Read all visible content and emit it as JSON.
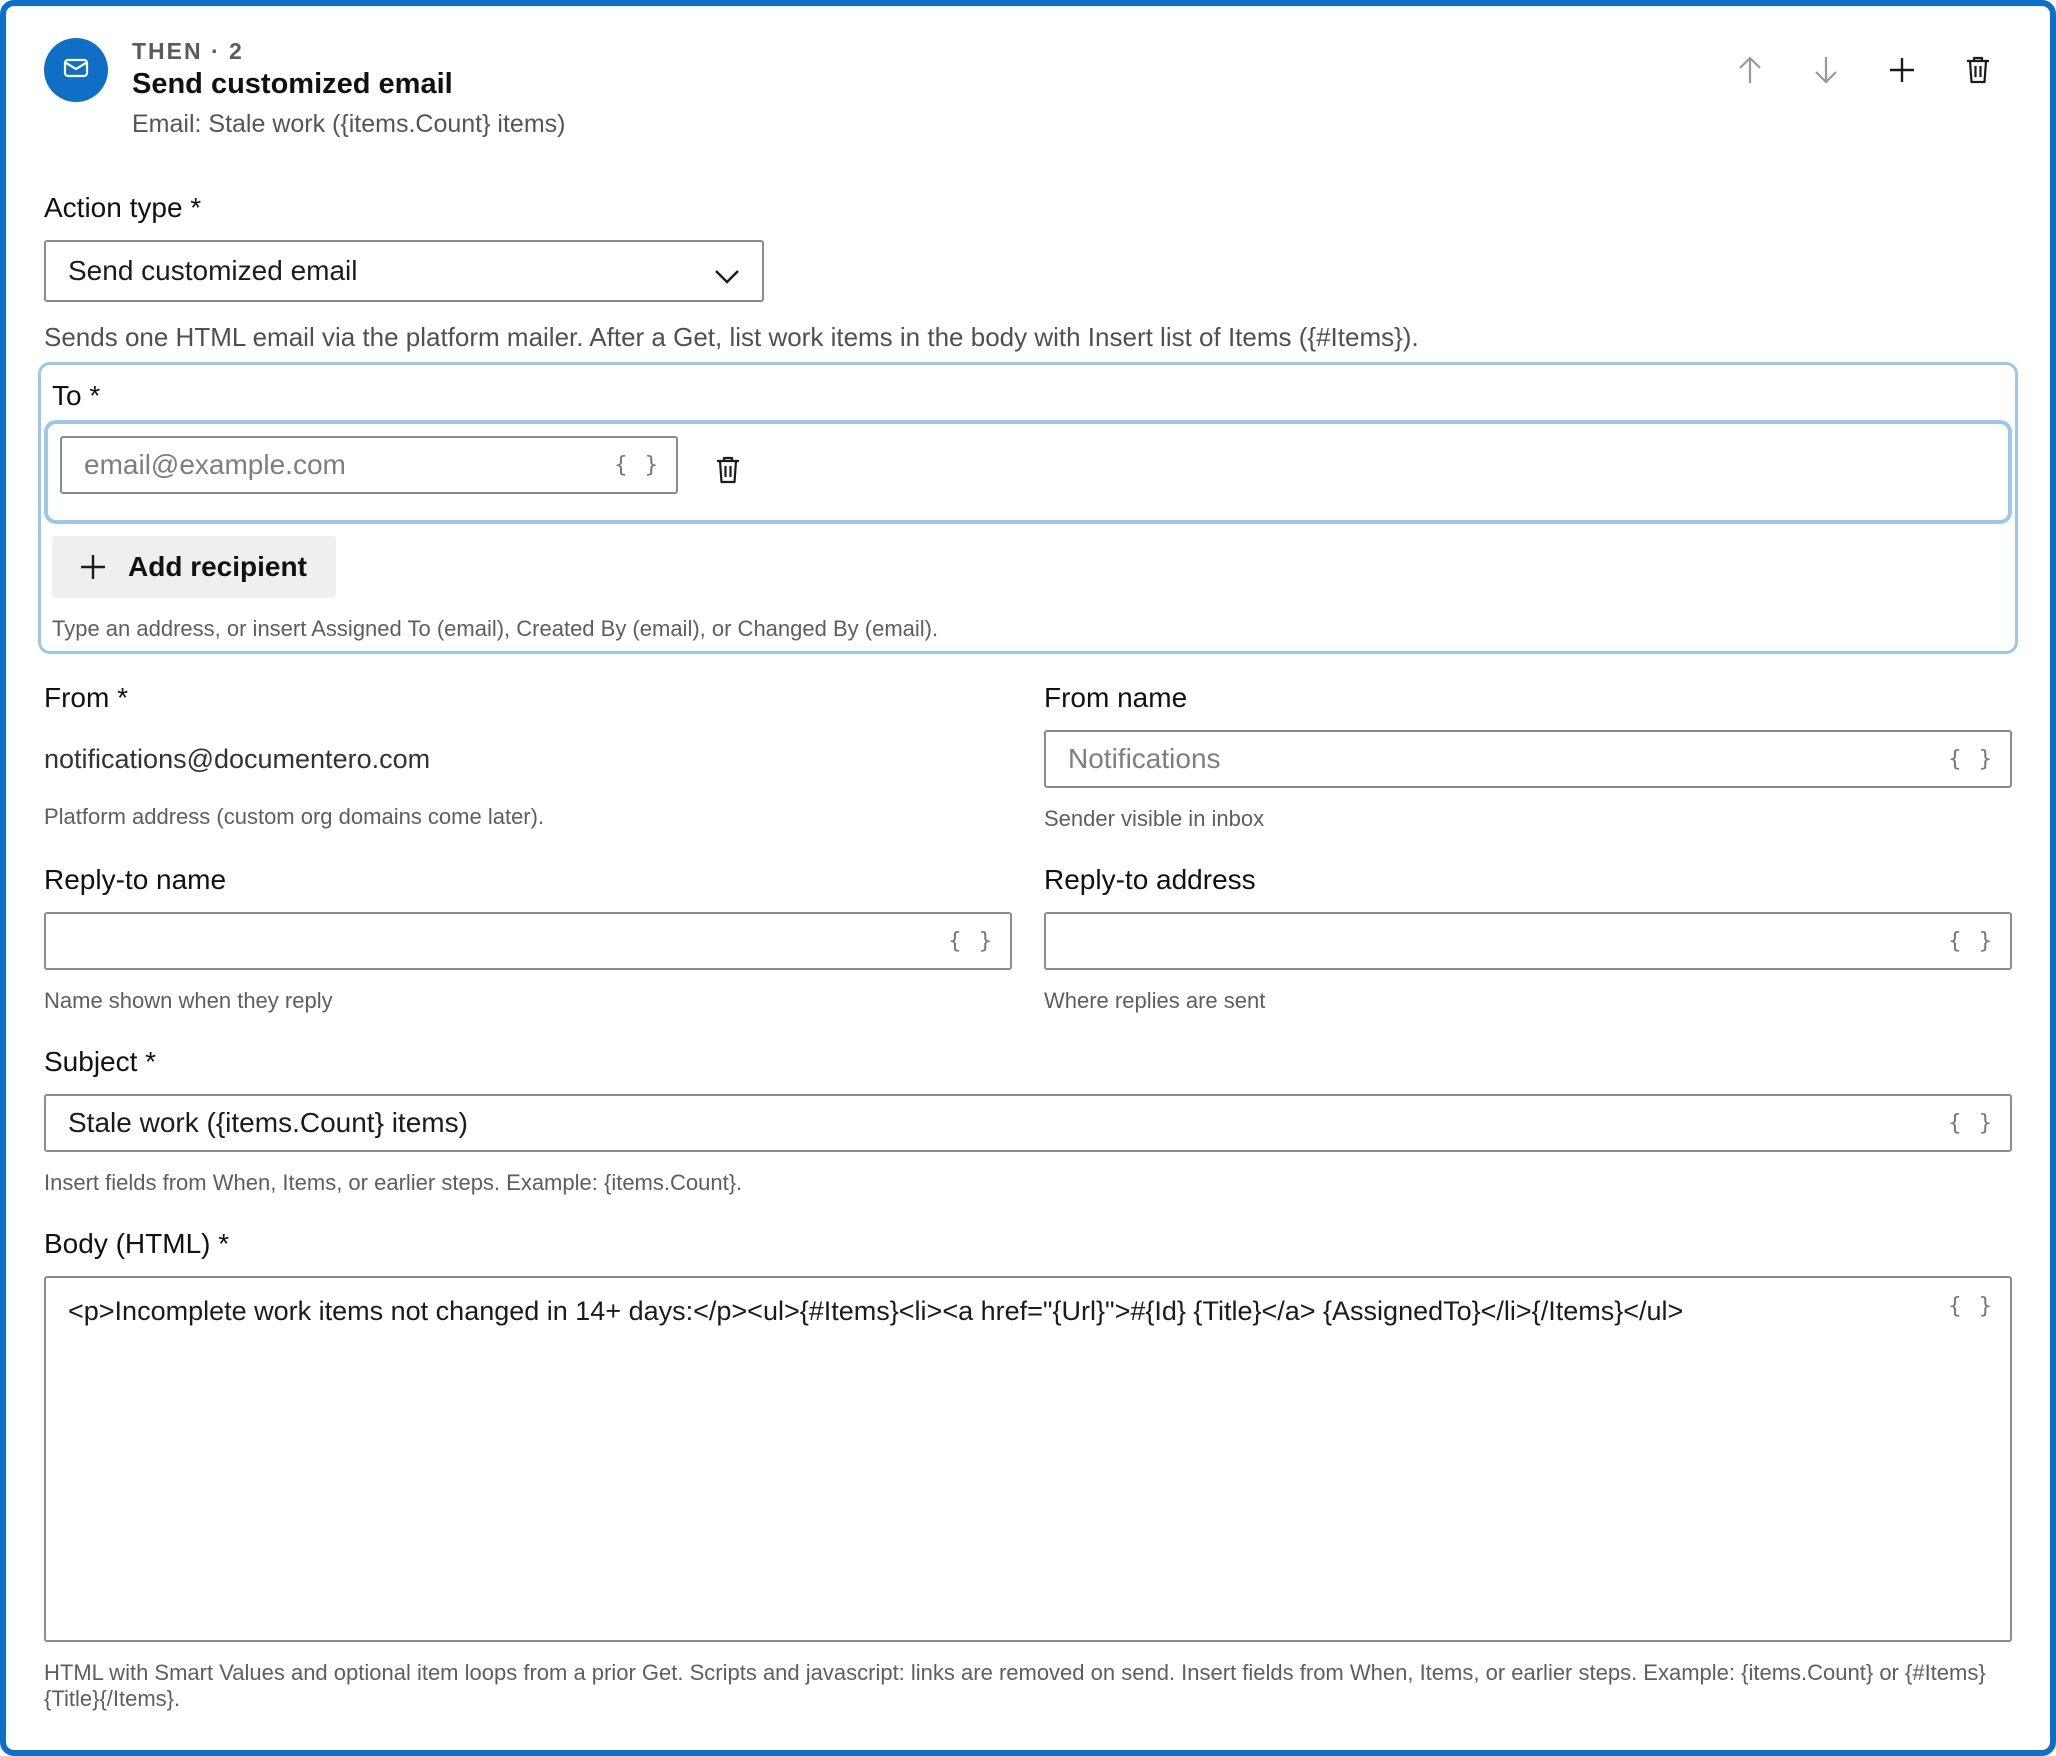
{
  "header": {
    "step_label": "THEN · 2",
    "title": "Send customized email",
    "subtitle": "Email: Stale work ({items.Count} items)",
    "icon": "mail-icon"
  },
  "toolbar": {
    "move_up_icon": "arrow-up-icon",
    "move_down_icon": "arrow-down-icon",
    "add_icon": "plus-icon",
    "delete_icon": "trash-icon"
  },
  "action_type": {
    "label": "Action type *",
    "value": "Send customized email",
    "description": "Sends one HTML email via the platform mailer. After a Get, list work items in the body with Insert list of Items ({#Items})."
  },
  "to": {
    "label": "To *",
    "placeholder": "email@example.com",
    "braces": "{ }",
    "add_label": "Add recipient",
    "hint": "Type an address, or insert Assigned To (email), Created By (email), or Changed By (email)."
  },
  "from": {
    "label": "From *",
    "value": "notifications@documentero.com",
    "hint": "Platform address (custom org domains come later)."
  },
  "from_name": {
    "label": "From name",
    "placeholder": "Notifications",
    "braces": "{ }",
    "hint": "Sender visible in inbox"
  },
  "reply_name": {
    "label": "Reply-to name",
    "value": "",
    "braces": "{ }",
    "hint": "Name shown when they reply"
  },
  "reply_address": {
    "label": "Reply-to address",
    "value": "",
    "braces": "{ }",
    "hint": "Where replies are sent"
  },
  "subject": {
    "label": "Subject *",
    "value": "Stale work ({items.Count} items)",
    "braces": "{ }",
    "hint": "Insert fields from When, Items, or earlier steps. Example: {items.Count}."
  },
  "body": {
    "label": "Body (HTML) *",
    "value": "<p>Incomplete work items not changed in 14+ days:</p><ul>{#Items}<li><a href=\"{Url}\">#{Id} {Title}</a> {AssignedTo}</li>{/Items}</ul>",
    "braces": "{ }",
    "hint": "HTML with Smart Values and optional item loops from a prior Get. Scripts and javascript: links are removed on send. Insert fields from When, Items, or earlier steps. Example: {items.Count} or {#Items}{Title}{/Items}."
  },
  "colors": {
    "accent": "#0f6fc7",
    "focus_border": "#9cc7e8"
  }
}
